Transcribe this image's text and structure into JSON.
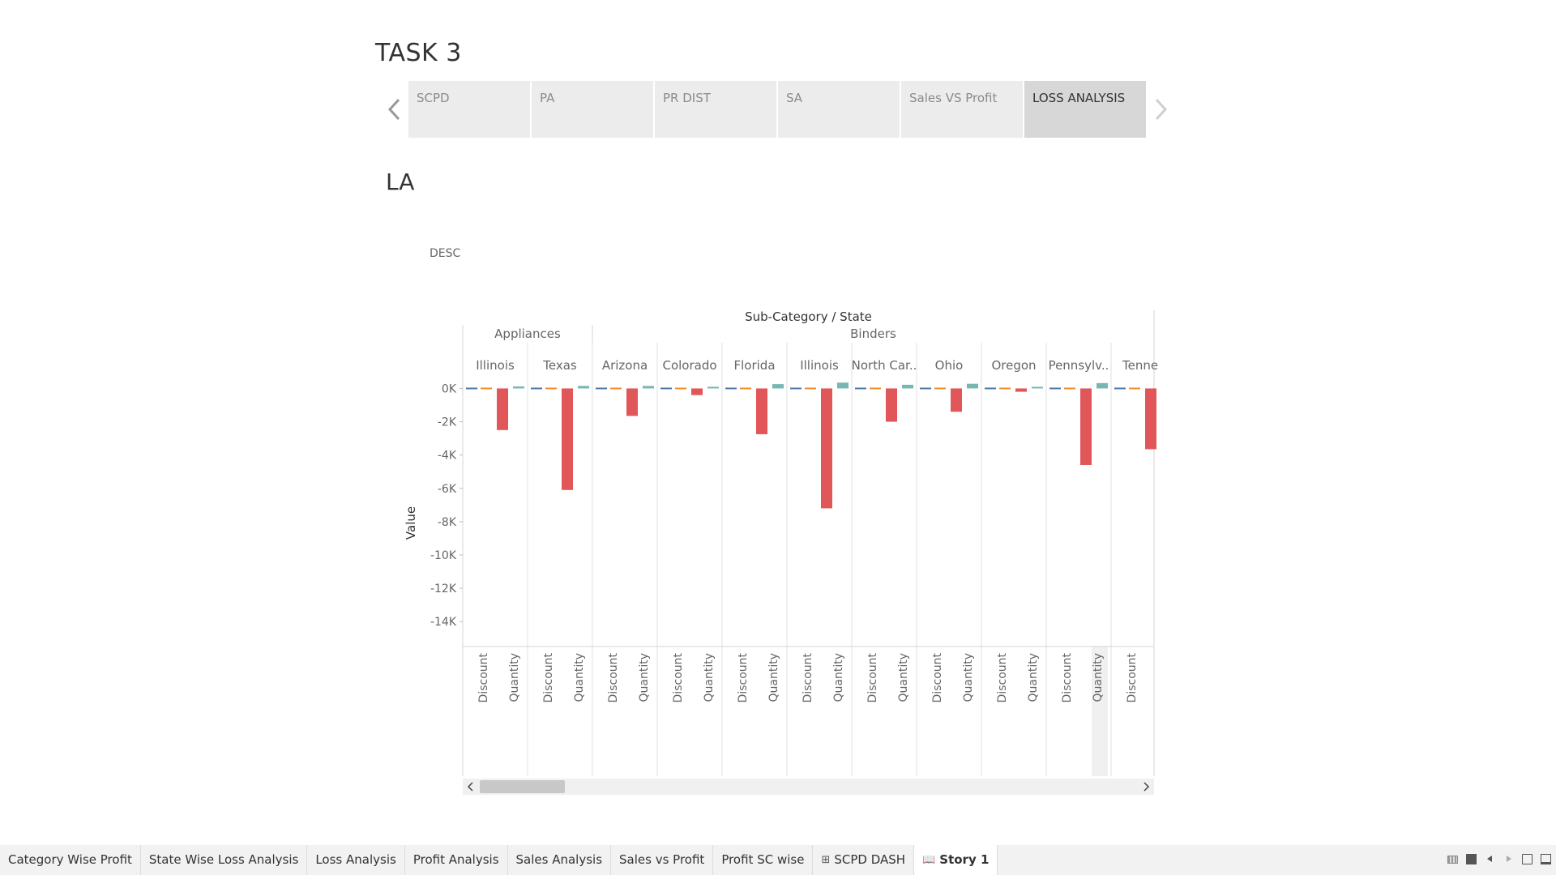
{
  "story": {
    "title": "TASK 3",
    "points": [
      "SCPD",
      "PA",
      "PR DIST",
      "SA",
      "Sales VS Profit",
      "LOSS ANALYSIS"
    ],
    "active_point": "LOSS ANALYSIS"
  },
  "sheet": {
    "title": "LA",
    "description": "DESC"
  },
  "bottom_tabs": [
    {
      "label": "Category Wise Profit"
    },
    {
      "label": "State Wise Loss Analysis"
    },
    {
      "label": "Loss Analysis"
    },
    {
      "label": "Profit Analysis"
    },
    {
      "label": "Sales Analysis"
    },
    {
      "label": "Sales vs Profit"
    },
    {
      "label": "Profit SC wise"
    },
    {
      "label": "SCPD DASH",
      "icon": "dashboard-icon"
    },
    {
      "label": "Story 1",
      "icon": "story-book-icon"
    }
  ],
  "chart_data": {
    "type": "bar",
    "header_title": "Sub-Category / State",
    "ylabel": "Value",
    "ylim": [
      -15500,
      800
    ],
    "yticks": [
      0,
      -2000,
      -4000,
      -6000,
      -8000,
      -10000,
      -12000,
      -14000
    ],
    "ytick_labels": [
      "0K",
      "-2K",
      "-4K",
      "-6K",
      "-8K",
      "-10K",
      "-12K",
      "-14K"
    ],
    "measures": [
      "Discount",
      "Quantity"
    ],
    "measure_colors": {
      "Discount": "#f28e2b",
      "Quantity": "#76b7b2"
    },
    "profit_color": "#e15759",
    "subcategories": [
      {
        "name": "Appliances",
        "span": 2
      },
      {
        "name": "Binders",
        "span": 9
      }
    ],
    "states": [
      {
        "label": "Illinois",
        "subcategory": "Appliances",
        "profit": -2500,
        "discount": 0,
        "quantity": 120
      },
      {
        "label": "Texas",
        "subcategory": "Appliances",
        "profit": -6100,
        "discount": 0,
        "quantity": 150
      },
      {
        "label": "Arizona",
        "subcategory": "Binders",
        "profit": -1650,
        "discount": 0,
        "quantity": 150
      },
      {
        "label": "Colorado",
        "subcategory": "Binders",
        "profit": -400,
        "discount": 0,
        "quantity": 100
      },
      {
        "label": "Florida",
        "subcategory": "Binders",
        "profit": -2750,
        "discount": 0,
        "quantity": 260
      },
      {
        "label": "Illinois",
        "subcategory": "Binders",
        "profit": -7200,
        "discount": 0,
        "quantity": 350
      },
      {
        "label": "North Car..",
        "subcategory": "Binders",
        "profit": -2000,
        "discount": 0,
        "quantity": 220
      },
      {
        "label": "Ohio",
        "subcategory": "Binders",
        "profit": -1400,
        "discount": 0,
        "quantity": 280
      },
      {
        "label": "Oregon",
        "subcategory": "Binders",
        "profit": -200,
        "discount": 0,
        "quantity": 60
      },
      {
        "label": "Pennsylv..",
        "subcategory": "Binders",
        "profit": -4600,
        "discount": 0,
        "quantity": 320
      },
      {
        "label": "Tennes",
        "subcategory": "Binders",
        "profit": -3650,
        "discount": 0,
        "quantity": 0
      }
    ]
  }
}
